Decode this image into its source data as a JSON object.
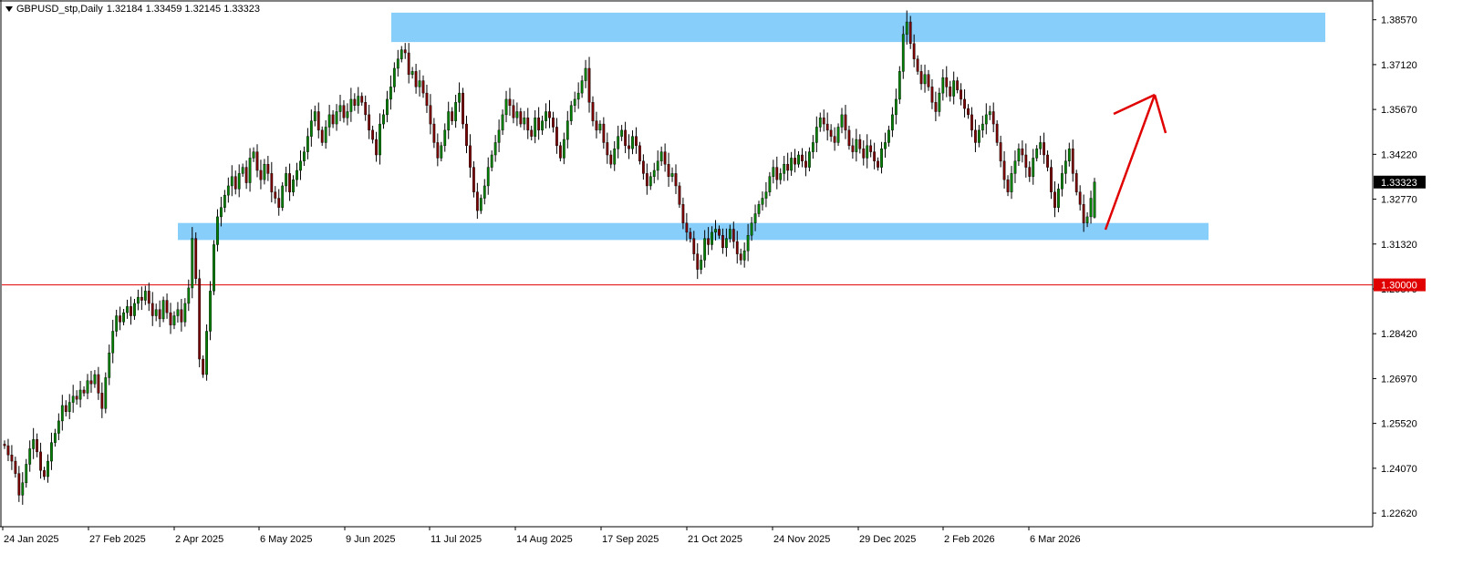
{
  "header": {
    "symbol_timeframe": "GBPUSD_stp,Daily",
    "ohlc": "1.32184 1.33459 1.32145 1.33323"
  },
  "price_axis": {
    "ticks": [
      "1.38570",
      "1.37120",
      "1.35670",
      "1.34220",
      "1.32770",
      "1.31320",
      "1.29870",
      "1.28420",
      "1.26970",
      "1.25520",
      "1.24070",
      "1.22620"
    ],
    "current_price_label": "1.33323",
    "level_label": "1.30000"
  },
  "time_axis": {
    "labels": [
      "24 Jan 2025",
      "27 Feb 2025",
      "2 Apr 2025",
      "6 May 2025",
      "9 Jun 2025",
      "11 Jul 2025",
      "14 Aug 2025",
      "17 Sep 2025",
      "21 Oct 2025",
      "24 Nov 2025",
      "29 Dec 2025",
      "2 Feb 2026",
      "6 Mar 2026"
    ]
  },
  "colors": {
    "bull": "#008000",
    "bear": "#7a0000",
    "zone": "#87cefa",
    "level_line": "#e00000",
    "arrow": "#e00000",
    "current_label_bg": "#000000"
  },
  "chart_data": {
    "type": "candlestick",
    "symbol": "GBPUSD_stp",
    "timeframe": "Daily",
    "last_bar": {
      "open": 1.32184,
      "high": 1.33459,
      "low": 1.32145,
      "close": 1.33323
    },
    "y_range": [
      1.2218,
      1.3915
    ],
    "horizontal_line": 1.3,
    "zones": [
      {
        "from": 1.3785,
        "to": 1.388
      },
      {
        "from": 1.3145,
        "to": 1.32
      }
    ],
    "closes": [
      1.248,
      1.245,
      1.243,
      1.239,
      1.232,
      1.236,
      1.242,
      1.247,
      1.25,
      1.246,
      1.24,
      1.238,
      1.243,
      1.249,
      1.252,
      1.256,
      1.261,
      1.259,
      1.262,
      1.264,
      1.263,
      1.266,
      1.265,
      1.269,
      1.268,
      1.271,
      1.265,
      1.26,
      1.27,
      1.278,
      1.285,
      1.29,
      1.288,
      1.291,
      1.293,
      1.29,
      1.294,
      1.296,
      1.295,
      1.298,
      1.294,
      1.29,
      1.292,
      1.289,
      1.295,
      1.291,
      1.287,
      1.29,
      1.292,
      1.288,
      1.294,
      1.299,
      1.315,
      1.302,
      1.276,
      1.271,
      1.285,
      1.298,
      1.313,
      1.322,
      1.325,
      1.329,
      1.332,
      1.335,
      1.331,
      1.336,
      1.338,
      1.333,
      1.341,
      1.343,
      1.337,
      1.334,
      1.339,
      1.336,
      1.33,
      1.328,
      1.325,
      1.332,
      1.336,
      1.33,
      1.334,
      1.337,
      1.34,
      1.343,
      1.348,
      1.353,
      1.356,
      1.35,
      1.346,
      1.351,
      1.355,
      1.352,
      1.356,
      1.358,
      1.354,
      1.356,
      1.36,
      1.358,
      1.361,
      1.359,
      1.355,
      1.35,
      1.347,
      1.342,
      1.352,
      1.355,
      1.36,
      1.364,
      1.37,
      1.373,
      1.376,
      1.375,
      1.368,
      1.369,
      1.364,
      1.366,
      1.362,
      1.358,
      1.352,
      1.346,
      1.341,
      1.345,
      1.35,
      1.356,
      1.353,
      1.359,
      1.362,
      1.352,
      1.345,
      1.338,
      1.33,
      1.324,
      1.328,
      1.332,
      1.338,
      1.342,
      1.346,
      1.35,
      1.355,
      1.36,
      1.358,
      1.354,
      1.356,
      1.352,
      1.354,
      1.35,
      1.348,
      1.354,
      1.35,
      1.353,
      1.356,
      1.354,
      1.351,
      1.345,
      1.341,
      1.347,
      1.353,
      1.358,
      1.36,
      1.362,
      1.366,
      1.37,
      1.359,
      1.353,
      1.35,
      1.352,
      1.346,
      1.342,
      1.339,
      1.344,
      1.348,
      1.35,
      1.345,
      1.344,
      1.348,
      1.345,
      1.34,
      1.336,
      1.332,
      1.335,
      1.337,
      1.34,
      1.343,
      1.339,
      1.335,
      1.336,
      1.332,
      1.326,
      1.32,
      1.317,
      1.315,
      1.31,
      1.305,
      1.308,
      1.315,
      1.313,
      1.317,
      1.318,
      1.316,
      1.312,
      1.315,
      1.318,
      1.314,
      1.31,
      1.308,
      1.311,
      1.316,
      1.32,
      1.323,
      1.326,
      1.328,
      1.33,
      1.335,
      1.338,
      1.334,
      1.336,
      1.339,
      1.337,
      1.341,
      1.339,
      1.342,
      1.34,
      1.338,
      1.343,
      1.346,
      1.351,
      1.354,
      1.352,
      1.35,
      1.348,
      1.346,
      1.351,
      1.355,
      1.35,
      1.345,
      1.343,
      1.347,
      1.344,
      1.341,
      1.345,
      1.343,
      1.34,
      1.338,
      1.344,
      1.346,
      1.35,
      1.355,
      1.36,
      1.369,
      1.381,
      1.385,
      1.378,
      1.373,
      1.369,
      1.365,
      1.368,
      1.364,
      1.359,
      1.356,
      1.362,
      1.367,
      1.364,
      1.361,
      1.366,
      1.363,
      1.36,
      1.357,
      1.355,
      1.35,
      1.346,
      1.35,
      1.352,
      1.355,
      1.356,
      1.352,
      1.346,
      1.34,
      1.334,
      1.33,
      1.336,
      1.34,
      1.344,
      1.342,
      1.338,
      1.335,
      1.341,
      1.344,
      1.346,
      1.342,
      1.338,
      1.33,
      1.325,
      1.331,
      1.336,
      1.34,
      1.344,
      1.336,
      1.33,
      1.326,
      1.32,
      1.322,
      1.328,
      1.3323
    ]
  }
}
